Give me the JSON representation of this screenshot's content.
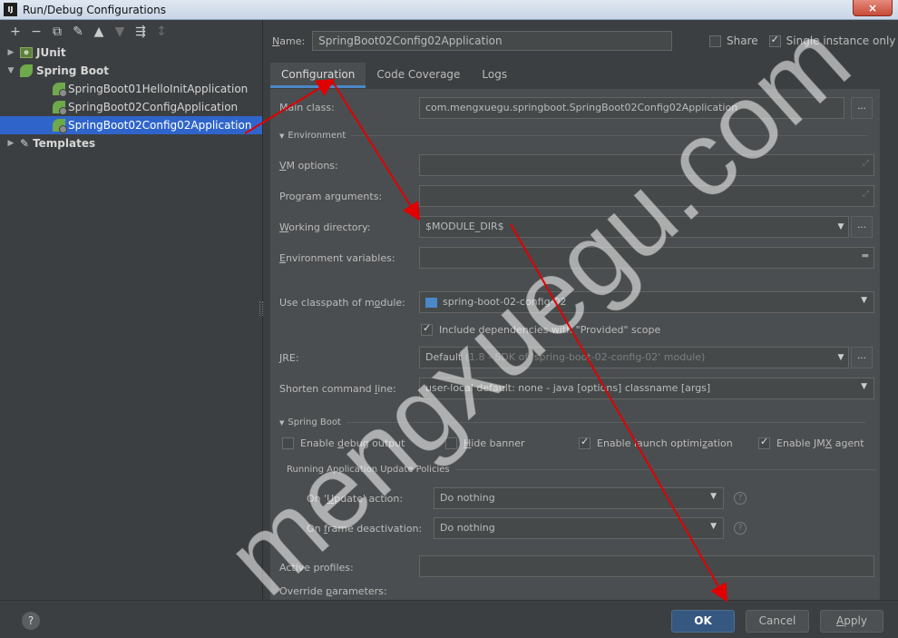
{
  "window": {
    "title": "Run/Debug Configurations",
    "close_label": "×",
    "app_icon_label": "IJ"
  },
  "toolbar": [
    "+",
    "−",
    "⧉",
    "✎",
    "▲",
    "▼",
    "⇶",
    "↕"
  ],
  "tree": {
    "junit": "JUnit",
    "spring_boot": "Spring Boot",
    "children": [
      "SpringBoot01HelloInitApplication",
      "SpringBoot02ConfigApplication",
      "SpringBoot02Config02Application"
    ],
    "templates": "Templates"
  },
  "name": {
    "label": "Name:",
    "value": "SpringBoot02Config02Application"
  },
  "share": {
    "label": "Share",
    "checked": false
  },
  "single_instance": {
    "label": "Single instance only",
    "checked": true
  },
  "tabs": [
    "Configuration",
    "Code Coverage",
    "Logs"
  ],
  "form": {
    "main_class": {
      "label": "Main class:",
      "value": "com.mengxuegu.springboot.SpringBoot02Config02Application",
      "button": "..."
    },
    "environment_section": "Environment",
    "vm_options": {
      "label": "VM options:",
      "value": ""
    },
    "program_arguments": {
      "label": "Program arguments:",
      "value": ""
    },
    "working_directory": {
      "label": "Working directory:",
      "value": "$MODULE_DIR$",
      "button": "..."
    },
    "environment_variables": {
      "label": "Environment variables:",
      "value": ""
    },
    "classpath_module": {
      "label": "Use classpath of module:",
      "value": "spring-boot-02-config-02"
    },
    "include_provided": {
      "label": "Include dependencies with \"Provided\" scope",
      "checked": true
    },
    "jre": {
      "label": "JRE:",
      "value_main": "Default",
      "value_detail": "(1.8 - SDK of 'spring-boot-02-config-02' module)",
      "button": "..."
    },
    "shorten": {
      "label": "Shorten command line:",
      "value": "user-local default: none - java [options] classname [args]"
    },
    "spring_boot_section": "Spring Boot",
    "enable_debug": {
      "label": "Enable debug output",
      "checked": false
    },
    "hide_banner": {
      "label": "Hide banner",
      "checked": false
    },
    "enable_launch": {
      "label": "Enable launch optimization",
      "checked": true
    },
    "enable_jmx": {
      "label": "Enable JMX agent",
      "checked": true
    },
    "policies_section": "Running Application Update Policies",
    "on_update": {
      "label": "On 'Update' action:",
      "value": "Do nothing"
    },
    "on_frame": {
      "label": "On frame deactivation:",
      "value": "Do nothing"
    },
    "active_profiles": {
      "label": "Active profiles:",
      "value": ""
    },
    "override_parameters": {
      "label": "Override parameters:"
    }
  },
  "buttons": {
    "help": "?",
    "ok": "OK",
    "cancel": "Cancel",
    "apply": "Apply"
  },
  "watermark": "mengxuegu.com",
  "colors": {
    "background": "#3c3f41",
    "panel": "#4b4e50",
    "selection": "#2f65ca",
    "accent": "#4a88c7",
    "annotation": "#e00000"
  }
}
